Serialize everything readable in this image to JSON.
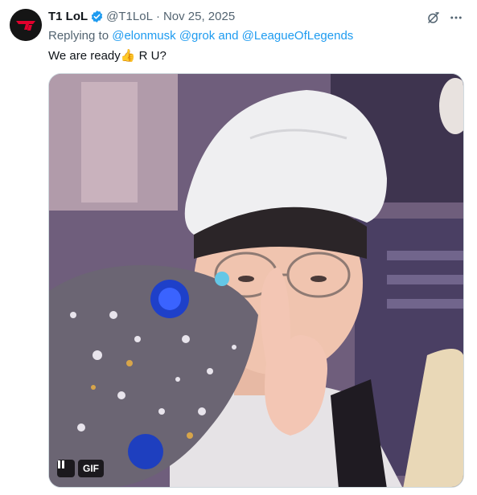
{
  "author": {
    "name": "T1 LoL",
    "handle": "@T1LoL",
    "separator": "·",
    "date": "Nov 25, 2025",
    "avatar_text": "T1",
    "verified_icon": "verified-badge-icon"
  },
  "reply": {
    "prefix": "Replying to",
    "mention1": "@elonmusk",
    "mention2": "@grok",
    "conjunction": "and",
    "mention3": "@LeagueOfLegends"
  },
  "tweet": {
    "text_before": "We are ready",
    "emoji": "👍",
    "text_after": " R U?"
  },
  "media": {
    "badge": "GIF",
    "pause_icon": "pause-icon"
  },
  "icons": {
    "grok": "grok-icon",
    "more": "more-options-icon"
  },
  "colors": {
    "accent": "#1d9bf0",
    "secondary_text": "#536471",
    "brand_red": "#e2012d"
  }
}
